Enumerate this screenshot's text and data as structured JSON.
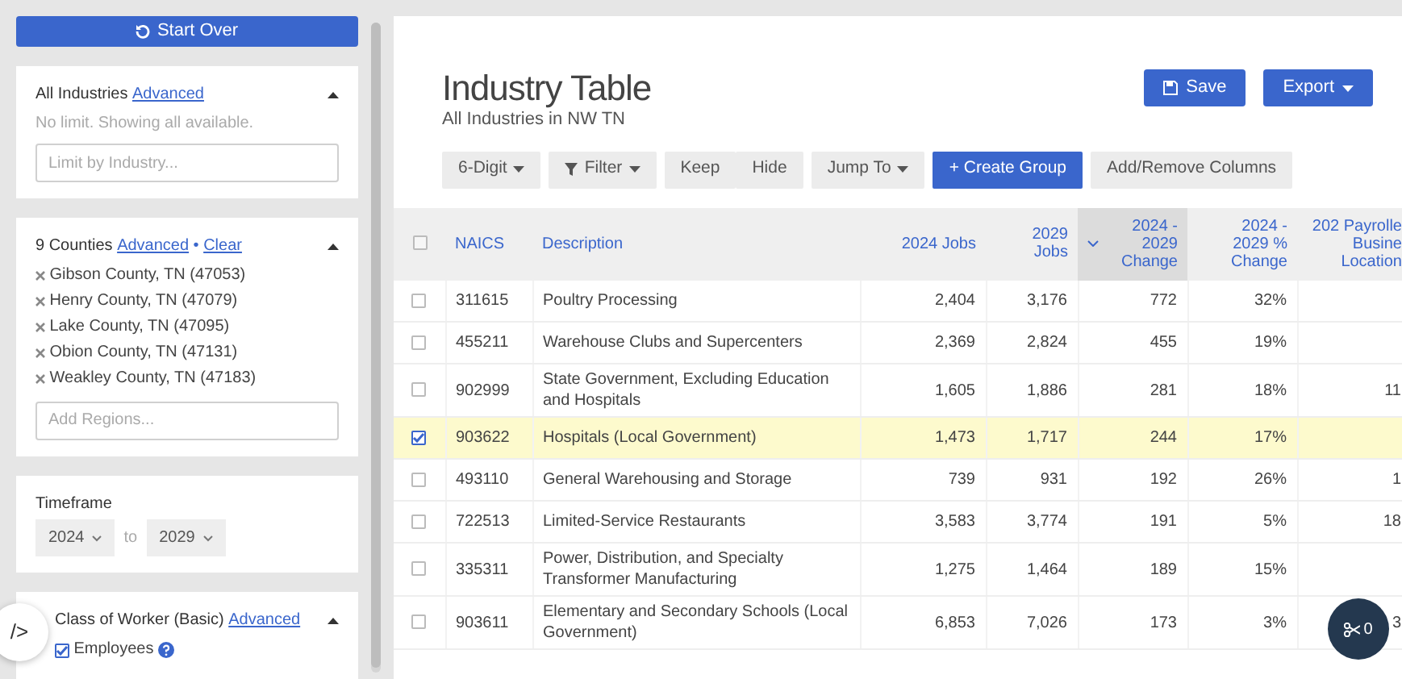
{
  "sidebar": {
    "start_over": "Start Over",
    "industries": {
      "title": "All Industries",
      "link": "Advanced",
      "expanded": true,
      "note": "No limit. Showing all available.",
      "placeholder": "Limit by Industry..."
    },
    "counties": {
      "title": "9 Counties",
      "link": "Advanced",
      "separator": "•",
      "clear": "Clear",
      "expanded": true,
      "regions": [
        "Gibson County, TN (47053)",
        "Henry County, TN (47079)",
        "Lake County, TN (47095)",
        "Obion County, TN (47131)",
        "Weakley County, TN (47183)"
      ],
      "placeholder": "Add Regions..."
    },
    "timeframe": {
      "title": "Timeframe",
      "from": "2024",
      "to_label": "to",
      "to": "2029"
    },
    "class_of_worker": {
      "title": "Class of Worker (Basic)",
      "link": "Advanced",
      "expanded": true,
      "options": [
        {
          "label": "Employees",
          "checked": true
        }
      ]
    }
  },
  "code_toggle": "/>",
  "main": {
    "title": "Industry Table",
    "subtitle": "All Industries in NW TN",
    "actions": [
      {
        "label": "Save",
        "kind": "save"
      },
      {
        "label": "Export",
        "kind": "dropdown"
      }
    ],
    "toolbar": [
      {
        "labels": [
          "6-Digit"
        ],
        "kind": "dropdown"
      },
      {
        "labels": [
          "Filter"
        ],
        "kind": "filter"
      },
      {
        "labels": [
          "Keep",
          "Hide"
        ],
        "kind": "pair"
      },
      {
        "labels": [
          "Jump To"
        ],
        "kind": "dropdown"
      },
      {
        "labels": [
          "+ Create Group"
        ],
        "kind": "primary"
      },
      {
        "labels": [
          "Add/Remove Columns"
        ],
        "kind": "plain"
      }
    ],
    "table": {
      "select_all_checked": false,
      "columns": [
        {
          "label": "NAICS",
          "sorted": false
        },
        {
          "label": "Description",
          "sorted": false
        },
        {
          "label": "2024 Jobs",
          "sorted": false
        },
        {
          "label": "2029 Jobs",
          "sorted": false
        },
        {
          "label": "2024 - 2029 Change",
          "sorted": true
        },
        {
          "label": "2024 - 2029 % Change",
          "sorted": false
        },
        {
          "label": "202 Payrolle Busine Location",
          "sorted": false
        }
      ],
      "rows": [
        {
          "selected": false,
          "cells": [
            "311615",
            "Poultry Processing",
            "2,404",
            "3,176",
            "772",
            "32%"
          ]
        },
        {
          "selected": false,
          "cells": [
            "455211",
            "Warehouse Clubs and Supercenters",
            "2,369",
            "2,824",
            "455",
            "19%"
          ]
        },
        {
          "selected": false,
          "cells": [
            "902999",
            "State Government, Excluding Education and Hospitals",
            "1,605",
            "1,886",
            "281",
            "18%",
            "11"
          ]
        },
        {
          "selected": true,
          "cells": [
            "903622",
            "Hospitals (Local Government)",
            "1,473",
            "1,717",
            "244",
            "17%"
          ]
        },
        {
          "selected": false,
          "cells": [
            "493110",
            "General Warehousing and Storage",
            "739",
            "931",
            "192",
            "26%",
            "1"
          ]
        },
        {
          "selected": false,
          "cells": [
            "722513",
            "Limited-Service Restaurants",
            "3,583",
            "3,774",
            "191",
            "5%",
            "18"
          ]
        },
        {
          "selected": false,
          "cells": [
            "335311",
            "Power, Distribution, and Specialty Transformer Manufacturing",
            "1,275",
            "1,464",
            "189",
            "15%"
          ]
        },
        {
          "selected": false,
          "cells": [
            "903611",
            "Elementary and Secondary Schools (Local Government)",
            "6,853",
            "7,026",
            "173",
            "3%",
            "3"
          ]
        }
      ]
    }
  },
  "scissors_count": "0"
}
